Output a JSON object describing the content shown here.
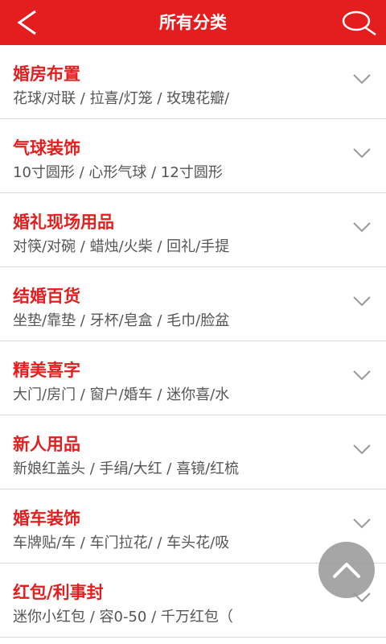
{
  "header": {
    "title": "所有分类",
    "back_icon": "back-arrow-icon",
    "search_icon": "search-icon",
    "color": "#e41e1e"
  },
  "categories": [
    {
      "title": "婚房布置",
      "subtitle": "花球/对联 / 拉喜/灯笼 / 玫瑰花瓣/"
    },
    {
      "title": "气球装饰",
      "subtitle": "10寸圆形 / 心形气球 / 12寸圆形"
    },
    {
      "title": "婚礼现场用品",
      "subtitle": "对筷/对碗 / 蜡烛/火柴 / 回礼/手提"
    },
    {
      "title": "结婚百货",
      "subtitle": "坐垫/靠垫 / 牙杯/皂盒 / 毛巾/脸盆"
    },
    {
      "title": "精美喜字",
      "subtitle": "大门/房门 / 窗户/婚车 / 迷你喜/水"
    },
    {
      "title": "新人用品",
      "subtitle": "新娘红盖头 / 手绢/大红 / 喜镜/红梳"
    },
    {
      "title": "婚车装饰",
      "subtitle": "车牌贴/车 / 车门拉花/ / 车头花/吸"
    },
    {
      "title": "红包/利事封",
      "subtitle": "迷你小红包 / 容0-50 / 千万红包（"
    }
  ],
  "fab": {
    "icon": "chevron-up-icon"
  }
}
